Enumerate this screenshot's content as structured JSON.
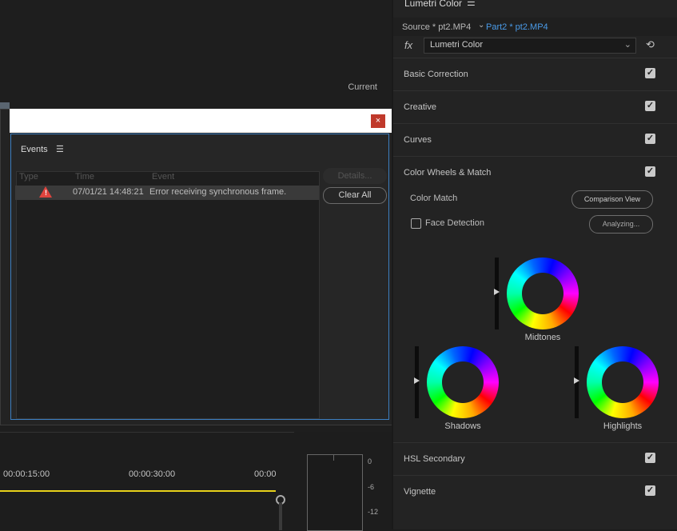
{
  "monitor": {
    "current_label": "Current"
  },
  "dialog": {
    "close_label": "×",
    "panel_title": "Events",
    "menu_icon": "☰",
    "columns": [
      "Type",
      "Time",
      "Event"
    ],
    "row": {
      "icon": "warning-icon",
      "time": "07/01/21 14:48:21",
      "message": "Error receiving synchronous frame."
    },
    "details_label": "Details...",
    "clear_label": "Clear All"
  },
  "timeline": {
    "tc1": "00:00:15:00",
    "tc2": "00:00:30:00",
    "tc3": "00:00"
  },
  "meter": {
    "ticks": [
      "0",
      "-6",
      "-12"
    ]
  },
  "lumetri": {
    "title": "Lumetri Color",
    "menu_icon": "☰",
    "source": "Source * pt2.MP4",
    "source_chev": "⌄",
    "part": "Part2 * pt2.MP4",
    "fx": "fx",
    "effect": "Lumetri Color",
    "effect_chev": "⌄",
    "reset_icon": "⟲",
    "sections": [
      "Basic Correction",
      "Creative",
      "Curves",
      "Color Wheels & Match",
      "HSL Secondary",
      "Vignette"
    ],
    "check": "✓",
    "color_match": "Color Match",
    "comparison_view": "Comparison View",
    "face_detection": "Face Detection",
    "analyzing": "Analyzing...",
    "midtones": "Midtones",
    "shadows": "Shadows",
    "highlights": "Highlights"
  }
}
